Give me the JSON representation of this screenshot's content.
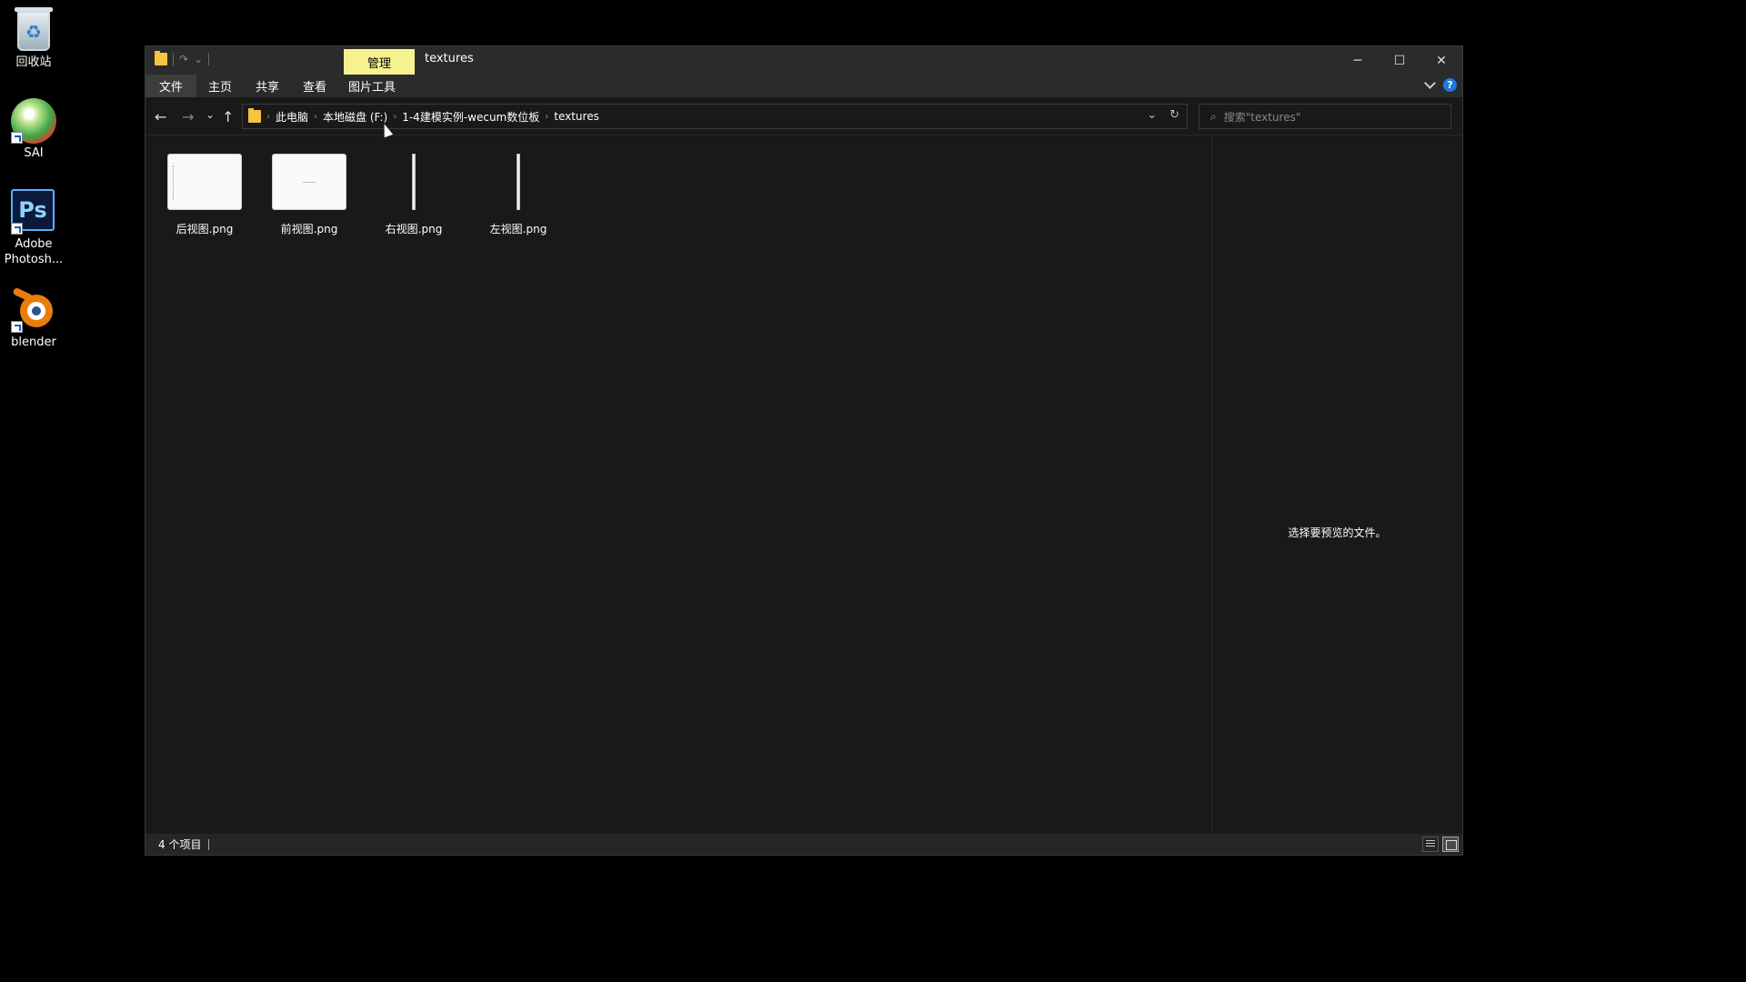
{
  "desktop": {
    "icons": [
      {
        "label": "回收站",
        "icon": "recycle-bin-icon"
      },
      {
        "label": "SAI",
        "icon": "sai-icon"
      },
      {
        "label": "Adobe Photosh...",
        "icon": "photoshop-icon",
        "glyph": "Ps"
      },
      {
        "label": "blender",
        "icon": "blender-icon"
      }
    ]
  },
  "window": {
    "title": "textures",
    "manage_tab": "管理",
    "controls": {
      "minimize": "─",
      "maximize": "☐",
      "close": "✕"
    },
    "ribbon_tabs": [
      "文件",
      "主页",
      "共享",
      "查看",
      "图片工具"
    ],
    "nav": {
      "back": "←",
      "forward": "→",
      "recent": "⌄",
      "up": "↑",
      "refresh": "↻",
      "dropdown": "⌄"
    },
    "breadcrumb": [
      "此电脑",
      "本地磁盘 (F:)",
      "1-4建模实例-wecum数位板",
      "textures"
    ],
    "search_placeholder": "搜索\"textures\"",
    "files": [
      {
        "name": "后视图.png",
        "thumb": "wide"
      },
      {
        "name": "前视图.png",
        "thumb": "wide"
      },
      {
        "name": "右视图.png",
        "thumb": "thin"
      },
      {
        "name": "左视图.png",
        "thumb": "thin"
      }
    ],
    "preview_text": "选择要预览的文件。",
    "status": "4 个项目"
  },
  "colors": {
    "manage_tab": "#f6f28f",
    "folder": "#f4c542",
    "help": "#1d7ae0"
  }
}
